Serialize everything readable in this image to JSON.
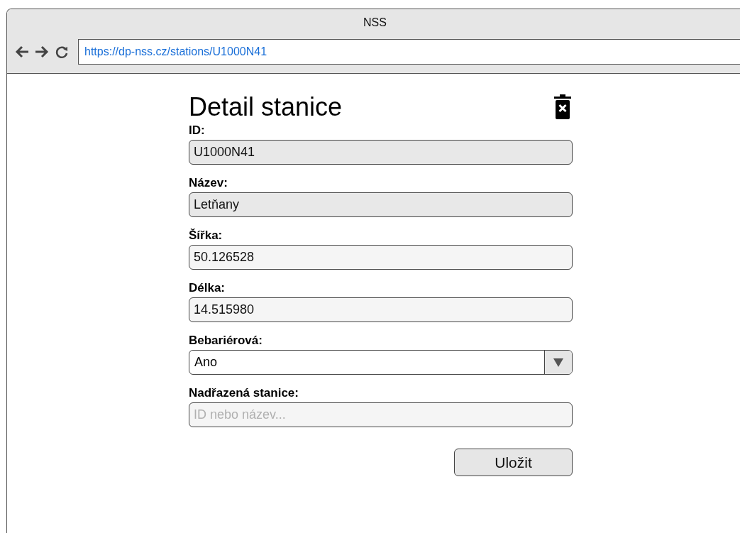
{
  "window": {
    "title": "NSS"
  },
  "address_bar": {
    "url": "https://dp-nss.cz/stations/U1000N41"
  },
  "page": {
    "heading": "Detail stanice",
    "fields": [
      {
        "kind": "text",
        "label": "ID:",
        "value": "U1000N41",
        "disabled": true
      },
      {
        "kind": "text",
        "label": "Název:",
        "value": "Letňany",
        "disabled": true
      },
      {
        "kind": "text",
        "label": "Šířka:",
        "value": "50.126528",
        "disabled": false
      },
      {
        "kind": "text",
        "label": "Délka:",
        "value": "14.515980",
        "disabled": false
      },
      {
        "kind": "select",
        "label": "Bebariérová:",
        "value": "Ano",
        "disabled": false
      },
      {
        "kind": "text",
        "label": "Nadřazená stanice:",
        "placeholder": "ID nebo název...",
        "disabled": false
      }
    ],
    "save_button": "Uložit"
  }
}
